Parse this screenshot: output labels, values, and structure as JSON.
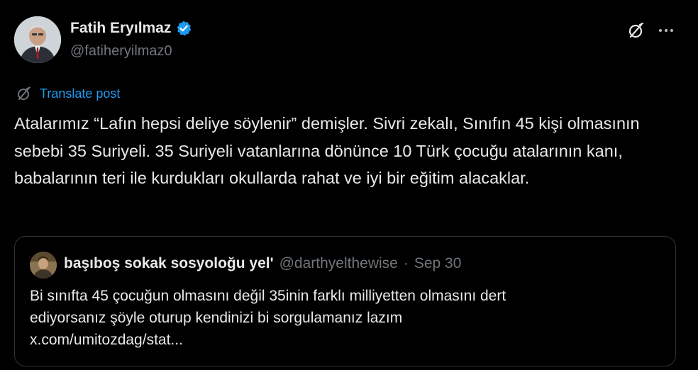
{
  "author": {
    "name": "Fatih Eryılmaz",
    "handle": "@fatiheryilmaz0",
    "verified": true
  },
  "icons": {
    "grok": "grok-icon",
    "more": "more-icon",
    "verified": "verified-badge-icon",
    "translate": "translate-icon"
  },
  "colors": {
    "background": "#000000",
    "text": "#e7e9ea",
    "muted": "#71767b",
    "accent": "#1d9bf0",
    "border": "#2f3336"
  },
  "translate": {
    "label": "Translate post"
  },
  "tweet": {
    "text": "Atalarımız “Lafın hepsi deliye söylenir” demişler. Sivri zekalı, Sınıfın 45 kişi olmasının sebebi 35 Suriyeli. 35 Suriyeli vatanlarına dönünce 10 Türk çocuğu atalarının kanı, babalarının teri ile kurdukları okullarda rahat ve iyi bir eğitim alacaklar."
  },
  "quote": {
    "name": "başıboş sokak sosyoloğu yel'",
    "handle": "@darthyelthewise",
    "separator": "·",
    "date": "Sep 30",
    "text_line1": "Bi sınıfta 45 çocuğun olmasını değil 35inin farklı milliyetten olmasını dert",
    "text_line2": "ediyorsanız şöyle oturup kendinizi bi sorgulamanız lazım",
    "text_line3": "x.com/umitozdag/stat..."
  }
}
